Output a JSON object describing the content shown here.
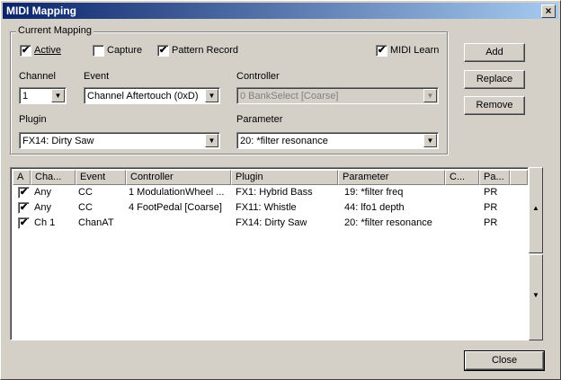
{
  "window": {
    "title": "MIDI Mapping",
    "close_glyph": "×"
  },
  "current_mapping": {
    "group_label": "Current Mapping",
    "active": {
      "label": "Active",
      "checked": true
    },
    "capture": {
      "label": "Capture",
      "checked": false
    },
    "pattern_record": {
      "label": "Pattern Record",
      "checked": true
    },
    "midi_learn": {
      "label": "MIDI Learn",
      "checked": true
    },
    "channel": {
      "label": "Channel",
      "value": "1"
    },
    "event": {
      "label": "Event",
      "value": "Channel Aftertouch (0xD)"
    },
    "controller": {
      "label": "Controller",
      "value": "0 BankSelect [Coarse]",
      "disabled": true
    },
    "plugin": {
      "label": "Plugin",
      "value": "FX14: Dirty Saw"
    },
    "parameter": {
      "label": "Parameter",
      "value": "20: *filter resonance"
    }
  },
  "buttons": {
    "add": "Add",
    "replace": "Replace",
    "remove": "Remove",
    "close": "Close"
  },
  "table": {
    "columns": [
      "A",
      "Cha...",
      "Event",
      "Controller",
      "Plugin",
      "Parameter",
      "C...",
      "Pa..."
    ],
    "rows": [
      {
        "active": true,
        "channel": "Any",
        "event": "CC",
        "controller": "1 ModulationWheel ...",
        "plugin": "FX1: Hybrid Bass",
        "parameter": "19: *filter freq",
        "c": "",
        "pa": "PR"
      },
      {
        "active": true,
        "channel": "Any",
        "event": "CC",
        "controller": "4 FootPedal [Coarse]",
        "plugin": "FX11: Whistle",
        "parameter": "44: lfo1 depth",
        "c": "",
        "pa": "PR"
      },
      {
        "active": true,
        "channel": "Ch 1",
        "event": "ChanAT",
        "controller": "",
        "plugin": "FX14: Dirty Saw",
        "parameter": "20: *filter resonance",
        "c": "",
        "pa": "PR"
      }
    ]
  },
  "icons": {
    "check": "✔",
    "dropdown": "▼",
    "scroll_up": "▲",
    "scroll_down": "▼"
  }
}
